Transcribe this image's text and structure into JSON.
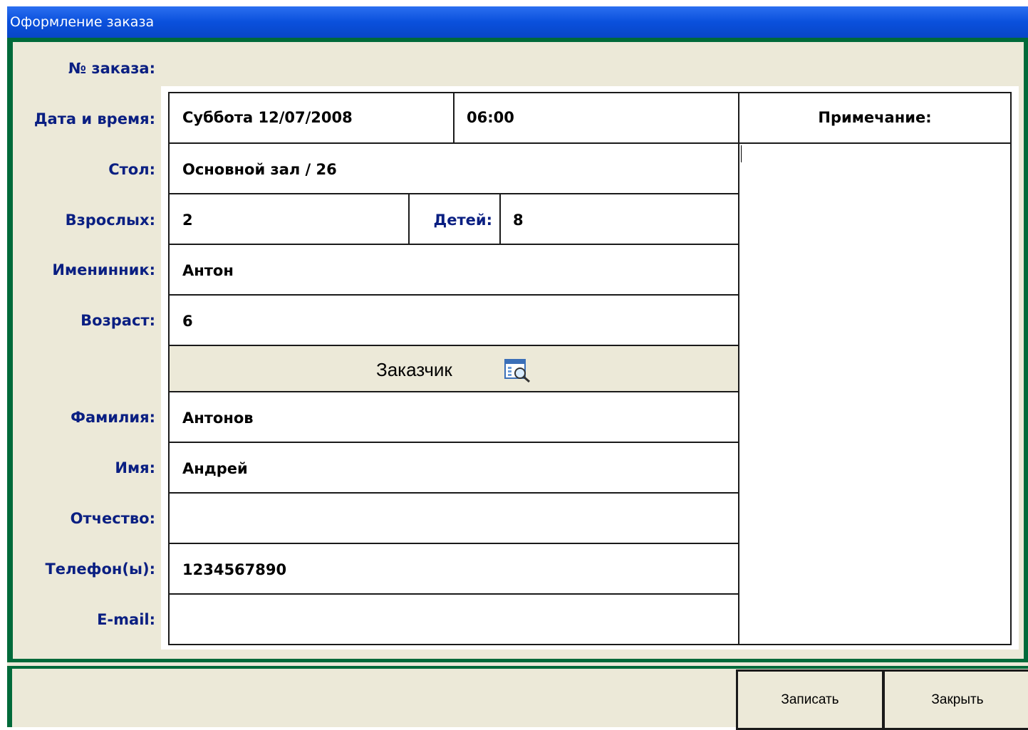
{
  "window": {
    "title": "Оформление заказа"
  },
  "labels": {
    "order_no": "№ заказа:",
    "datetime": "Дата и время:",
    "table": "Стол:",
    "adults": "Взрослых:",
    "children": "Детей:",
    "birthday_person": "Именинник:",
    "age": "Возраст:",
    "surname": "Фамилия:",
    "name": "Имя:",
    "patronymic": "Отчество:",
    "phones": "Телефон(ы):",
    "email": "E-mail:",
    "note": "Примечание:"
  },
  "values": {
    "date": "Суббота 12/07/2008",
    "time": "06:00",
    "table": "Основной зал / 26",
    "adults": "2",
    "children": "8",
    "birthday_person": "Антон",
    "age": "6",
    "surname": "Антонов",
    "name": "Андрей",
    "patronymic": "",
    "phones": "1234567890",
    "email": "",
    "note": ""
  },
  "customer_section": {
    "title": "Заказчик",
    "icon": "customer-lookup-icon"
  },
  "buttons": {
    "save": "Записать",
    "close": "Закрыть"
  },
  "colors": {
    "title_bar": "#0a50dc",
    "frame_green": "#006a3a",
    "label_blue": "#0a1f82",
    "panel": "#ece9d8"
  }
}
